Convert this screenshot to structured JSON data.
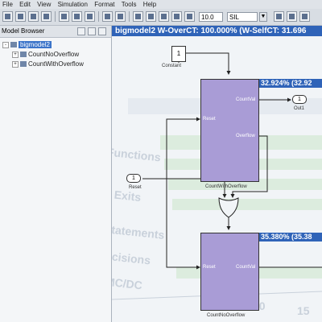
{
  "menu": [
    "File",
    "Edit",
    "View",
    "Simulation",
    "Format",
    "Tools",
    "Help"
  ],
  "toolbar": {
    "stop_time": "10.0",
    "sim_mode": "SIL"
  },
  "model_browser": {
    "title": "Model Browser",
    "items": [
      {
        "label": "bigmodel2",
        "expander": "-",
        "selected": true
      },
      {
        "label": "CountNoOverflow",
        "expander": "+"
      },
      {
        "label": "CountWithOverflow",
        "expander": "+"
      }
    ]
  },
  "canvas": {
    "title": "bigmodel2 W-OverCT: 100.000% (W-SelfCT: 31.696",
    "constant": {
      "value": "1",
      "label": "Constant"
    },
    "out1": {
      "value": "1",
      "label": "Out1"
    },
    "reset": {
      "value": "1",
      "label": "Reset"
    },
    "subsystem_top": {
      "name": "CountWithOverflow",
      "coverage": "32.924% (32.92",
      "ports": {
        "reset": "Reset",
        "countval": "CountVal",
        "overflow": "Overflow"
      }
    },
    "subsystem_bottom": {
      "name": "CountNoOverflow",
      "coverage": "35.380% (35.38",
      "ports": {
        "reset": "Reset",
        "countval": "CountVal"
      }
    },
    "ghost_labels": [
      "Functions",
      "Function Exits",
      "Statements",
      "Decisions",
      "MC/DC"
    ],
    "ghost_numbers": [
      "10",
      "15"
    ]
  },
  "colors": {
    "accent": "#2f63b8",
    "block_fill": "#a99cd6",
    "selection": "#3b74c9"
  }
}
